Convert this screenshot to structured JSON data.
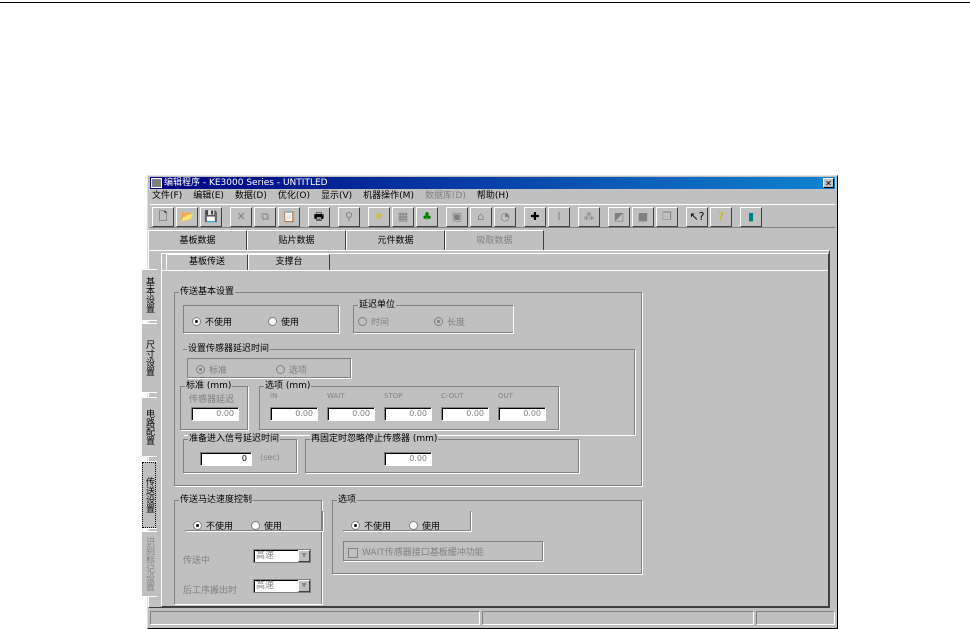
{
  "window": {
    "title": "编辑程序 - KE3000 Series - UNTITLED",
    "close": "✕"
  },
  "menu": [
    {
      "label": "文件(F)"
    },
    {
      "label": "编辑(E)"
    },
    {
      "label": "数据(D)"
    },
    {
      "label": "优化(O)"
    },
    {
      "label": "显示(V)"
    },
    {
      "label": "机器操作(M)"
    },
    {
      "label": "数据库(D)",
      "disabled": true
    },
    {
      "label": "帮助(H)"
    }
  ],
  "toolbar": [
    {
      "name": "new-icon",
      "glyph": "🗋"
    },
    {
      "name": "open-icon",
      "glyph": "📂"
    },
    {
      "name": "save-icon",
      "glyph": "💾"
    },
    {
      "name": "cut-icon",
      "glyph": "✕",
      "disabled": true
    },
    {
      "name": "copy-icon",
      "glyph": "⧉",
      "disabled": true
    },
    {
      "name": "paste-icon",
      "glyph": "📋",
      "disabled": true
    },
    {
      "name": "print-icon",
      "glyph": "🖶"
    },
    {
      "name": "find-icon",
      "glyph": "⚲",
      "disabled": true
    },
    {
      "name": "optimize-icon",
      "glyph": "☀"
    },
    {
      "name": "board-icon",
      "glyph": "▦",
      "disabled": true
    },
    {
      "name": "parts-icon",
      "glyph": "♣"
    },
    {
      "name": "mark-icon",
      "glyph": "▣",
      "disabled": true
    },
    {
      "name": "feeder-icon",
      "glyph": "⌂",
      "disabled": true
    },
    {
      "name": "nozzle-icon",
      "glyph": "◔",
      "disabled": true
    },
    {
      "name": "machine-icon",
      "glyph": "✚"
    },
    {
      "name": "align-icon",
      "glyph": "Ⅰ",
      "disabled": true
    },
    {
      "name": "view-icon",
      "glyph": "⁂",
      "disabled": true
    },
    {
      "name": "transfer-icon",
      "glyph": "◩",
      "disabled": true
    },
    {
      "name": "window-icon",
      "glyph": "■",
      "disabled": true
    },
    {
      "name": "cascade-icon",
      "glyph": "❐",
      "disabled": true
    },
    {
      "name": "context-help-icon",
      "glyph": "↖?"
    },
    {
      "name": "help-icon",
      "glyph": "?"
    },
    {
      "name": "exit-icon",
      "glyph": "▮"
    }
  ],
  "main_tabs": [
    {
      "label": "基板数据",
      "active": true
    },
    {
      "label": "贴片数据"
    },
    {
      "label": "元件数据"
    },
    {
      "label": "吸取数据",
      "disabled": true
    }
  ],
  "side_tabs": [
    {
      "label": "基本设置"
    },
    {
      "label": "尺寸设置"
    },
    {
      "label": "电路配置"
    },
    {
      "label": "传送设置",
      "focus": true
    },
    {
      "label": "识别标记设置",
      "disabled": true
    }
  ],
  "sub_tabs": [
    {
      "label": "基板传送",
      "active": true
    },
    {
      "label": "支撑台"
    }
  ],
  "transfer_basic": {
    "title": "传送基本设置",
    "opt_off": "不使用",
    "opt_on": "使用",
    "selected": "off"
  },
  "delay_unit": {
    "title": "延迟单位",
    "time": "时间",
    "length": "长度",
    "selected": "length"
  },
  "sensor_delay": {
    "title": "设置传感器延迟时间",
    "standard": "标准",
    "option": "选项",
    "selected": "standard",
    "std_group": "标准 (mm)",
    "std_label": "传感器延迟",
    "std_value": "0.00",
    "opt_group": "选项 (mm)",
    "fields": [
      {
        "label": "IN",
        "value": "0.00"
      },
      {
        "label": "WAIT",
        "value": "0.00"
      },
      {
        "label": "STOP",
        "value": "0.00"
      },
      {
        "label": "C-OUT",
        "value": "0.00"
      },
      {
        "label": "OUT",
        "value": "0.00"
      }
    ]
  },
  "ready_delay": {
    "title": "准备进入信号延迟时间",
    "value": "0",
    "unit": "(sec)"
  },
  "ignore_stop": {
    "title": "再固定时忽略停止传感器 (mm)",
    "value": "0.00"
  },
  "motor_speed": {
    "title": "传送马达速度控制",
    "opt_off": "不使用",
    "opt_on": "使用",
    "selected": "off",
    "conveying_label": "传送中",
    "conveying_value": "高速",
    "outflow_label": "后工序搬出时",
    "outflow_value": "高速"
  },
  "options": {
    "title": "选项",
    "opt_off": "不使用",
    "opt_on": "使用",
    "selected": "off",
    "checkbox": "WAIT传感器接口基板缓冲功能",
    "checked": false
  }
}
